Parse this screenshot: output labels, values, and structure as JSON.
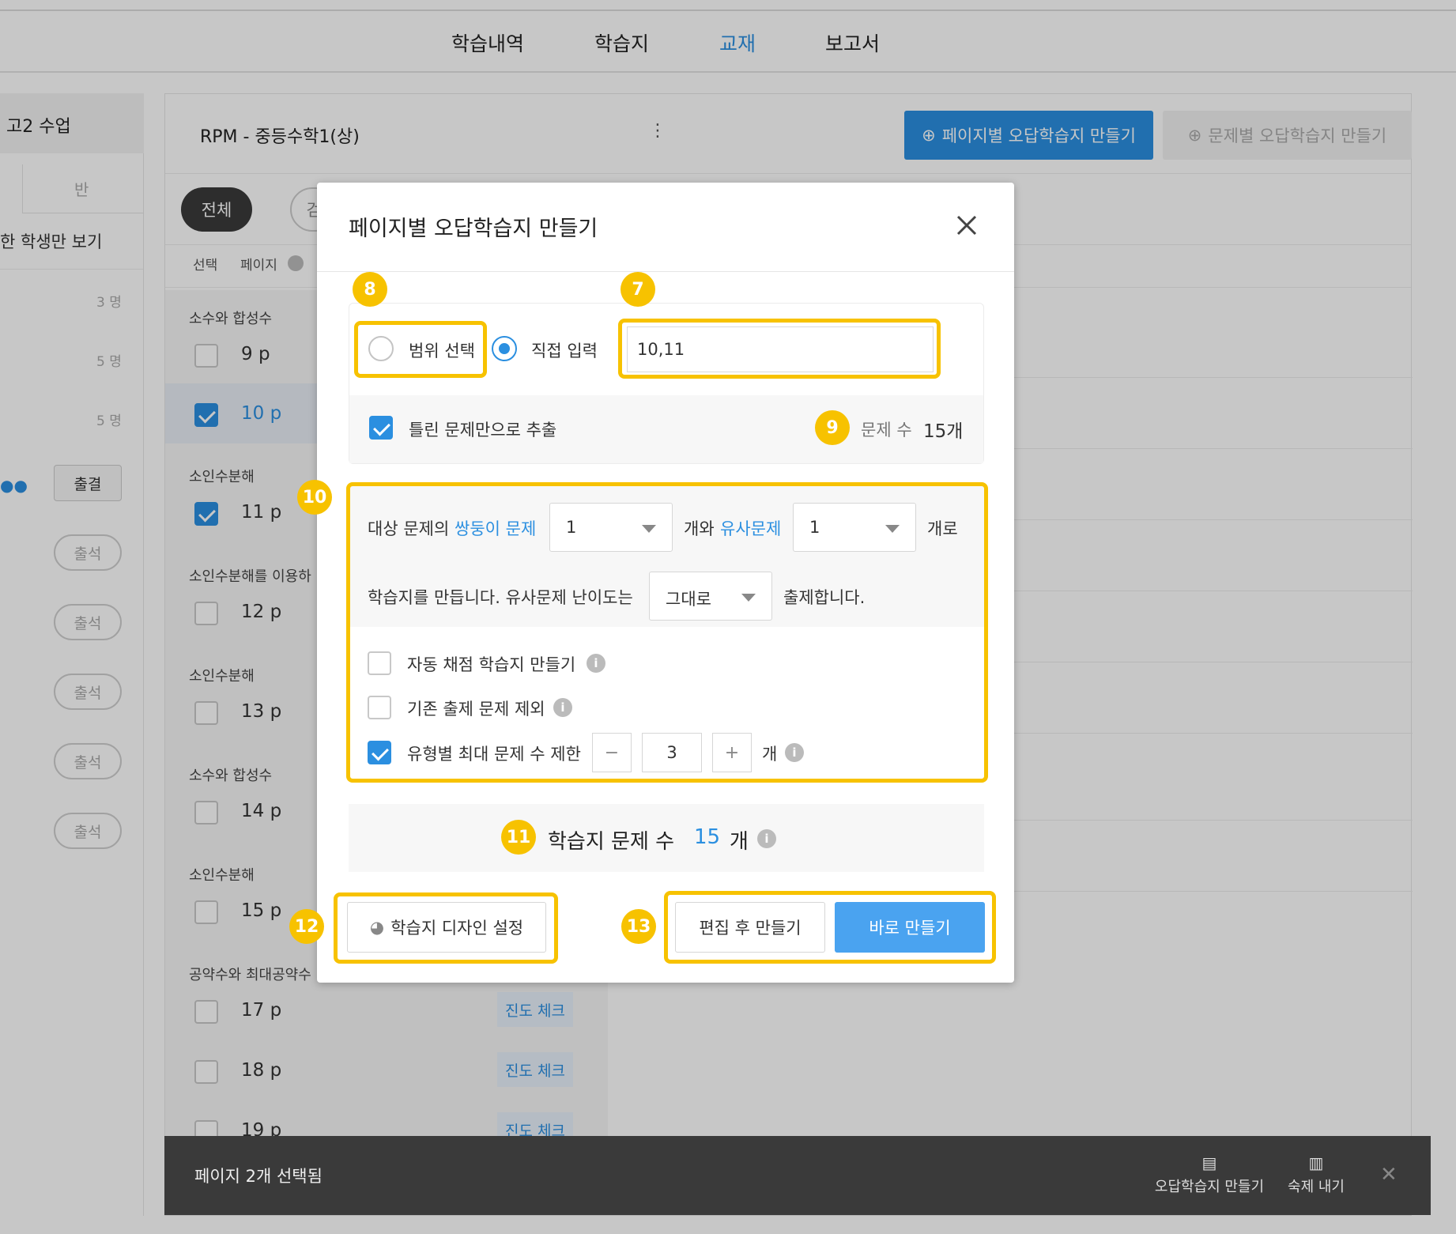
{
  "nav": {
    "items": [
      "학습내역",
      "학습지",
      "교재",
      "보고서"
    ],
    "active_index": 2
  },
  "left": {
    "class_name": "고2 수업",
    "tab_ban": "반",
    "filter_label": "한 학생만 보기",
    "counts": [
      "3 명",
      "5 명",
      "5 명"
    ],
    "attendance_button": "출결",
    "attend_pill": "출석"
  },
  "main": {
    "book_title": "RPM - 중등수학1(상)",
    "create_page_button": "페이지별 오답학습지 만들기",
    "create_problem_button": "문제별 오답학습지 만들기",
    "filter_all": "전체",
    "filter_partial": "검",
    "col_select": "선택",
    "col_page": "페이지",
    "rows": [
      {
        "type": "section",
        "label": "소수와 합성수"
      },
      {
        "type": "page",
        "label": "9 p",
        "checked": false
      },
      {
        "type": "page",
        "label": "10 p",
        "checked": true
      },
      {
        "type": "section",
        "label": "소인수분해"
      },
      {
        "type": "page",
        "label": "11 p",
        "checked": true
      },
      {
        "type": "section",
        "label": "소인수분해를 이용하"
      },
      {
        "type": "page",
        "label": "12 p",
        "checked": false
      },
      {
        "type": "section",
        "label": "소인수분해"
      },
      {
        "type": "page",
        "label": "13 p",
        "checked": false
      },
      {
        "type": "section",
        "label": "소수와 합성수"
      },
      {
        "type": "page",
        "label": "14 p",
        "checked": false
      },
      {
        "type": "section",
        "label": "소인수분해"
      },
      {
        "type": "page",
        "label": "15 p",
        "checked": false
      },
      {
        "type": "section",
        "label": "공약수와 최대공약수"
      },
      {
        "type": "page",
        "label": "17 p",
        "checked": false
      },
      {
        "type": "page",
        "label": "18 p",
        "checked": false
      },
      {
        "type": "page",
        "label": "19 p",
        "checked": false
      }
    ],
    "progress_check": "진도 체크"
  },
  "bottom": {
    "selected_text": "페이지 2개 선택됨",
    "action_wrong": "오답학습지 만들기",
    "action_homework": "숙제 내기"
  },
  "modal": {
    "title": "페이지별 오답학습지 만들기",
    "radio_range": "범위 선택",
    "radio_direct": "직접 입력",
    "direct_input_value": "10,11",
    "wrong_only_label": "틀린 문제만으로 추출",
    "problem_count_label": "문제 수",
    "problem_count_value": "15개",
    "sentence_1a": "대상 문제의",
    "twin_link": "쌍둥이 문제",
    "twin_value": "1",
    "sentence_1b": "개와",
    "similar_link": "유사문제",
    "similar_value": "1",
    "sentence_1c": "개로",
    "sentence_2a": "학습지를 만듭니다. 유사문제 난이도는",
    "difficulty_value": "그대로",
    "sentence_2b": "출제합니다.",
    "opt_auto_grade": "자동 채점 학습지 만들기",
    "opt_exclude": "기존 출제 문제 제외",
    "opt_limit": "유형별 최대 문제 수 제한",
    "limit_value": "3",
    "limit_unit": "개",
    "total_label": "학습지 문제 수",
    "total_value": "15",
    "total_unit": "개",
    "design_button": "학습지 디자인 설정",
    "edit_button": "편집 후 만들기",
    "make_button": "바로 만들기",
    "badges": [
      "8",
      "7",
      "9",
      "10",
      "11",
      "12",
      "13"
    ]
  },
  "colors": {
    "accent": "#2b8fe0",
    "highlight": "#f7c200"
  }
}
